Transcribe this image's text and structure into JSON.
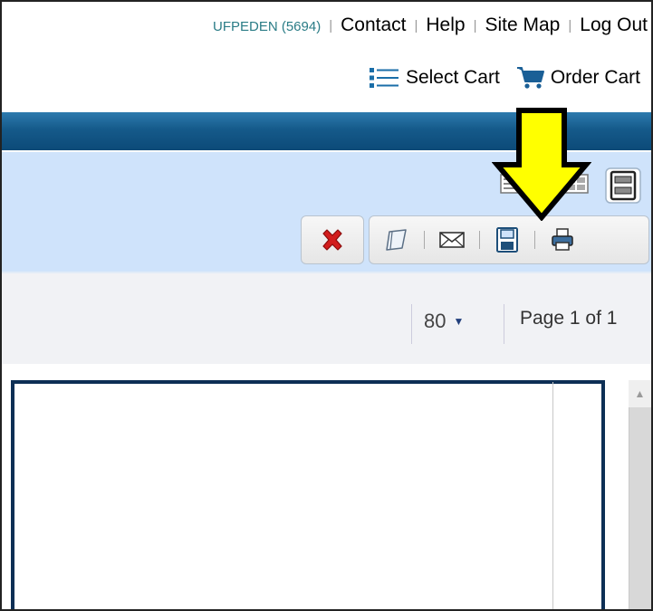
{
  "header": {
    "user": "UFPEDEN (5694)",
    "separator": "|",
    "links": [
      "Contact",
      "Help",
      "Site Map",
      "Log Out"
    ]
  },
  "cart_bar": {
    "select_cart": "Select Cart",
    "order_cart": "Order Cart",
    "select_cart_icon": "list-icon",
    "order_cart_icon": "shopping-cart-icon"
  },
  "toolbar": {
    "view_icons": [
      "list-view-icon",
      "grid-view-icon",
      "detail-view-icon"
    ],
    "delete_icon": "red-x-icon",
    "action_icons": [
      "folder-icon",
      "email-icon",
      "save-icon",
      "print-icon"
    ]
  },
  "pagination": {
    "page_size": "80",
    "page_info": "Page 1 of 1"
  },
  "annotation": {
    "arrow_color": "#ffff00",
    "points_to": "save-icon"
  },
  "colors": {
    "header_bar": "#155a8a",
    "toolbar_bg": "#cfe3fb",
    "user_text": "#2a7c86",
    "document_border": "#0d2f55"
  }
}
